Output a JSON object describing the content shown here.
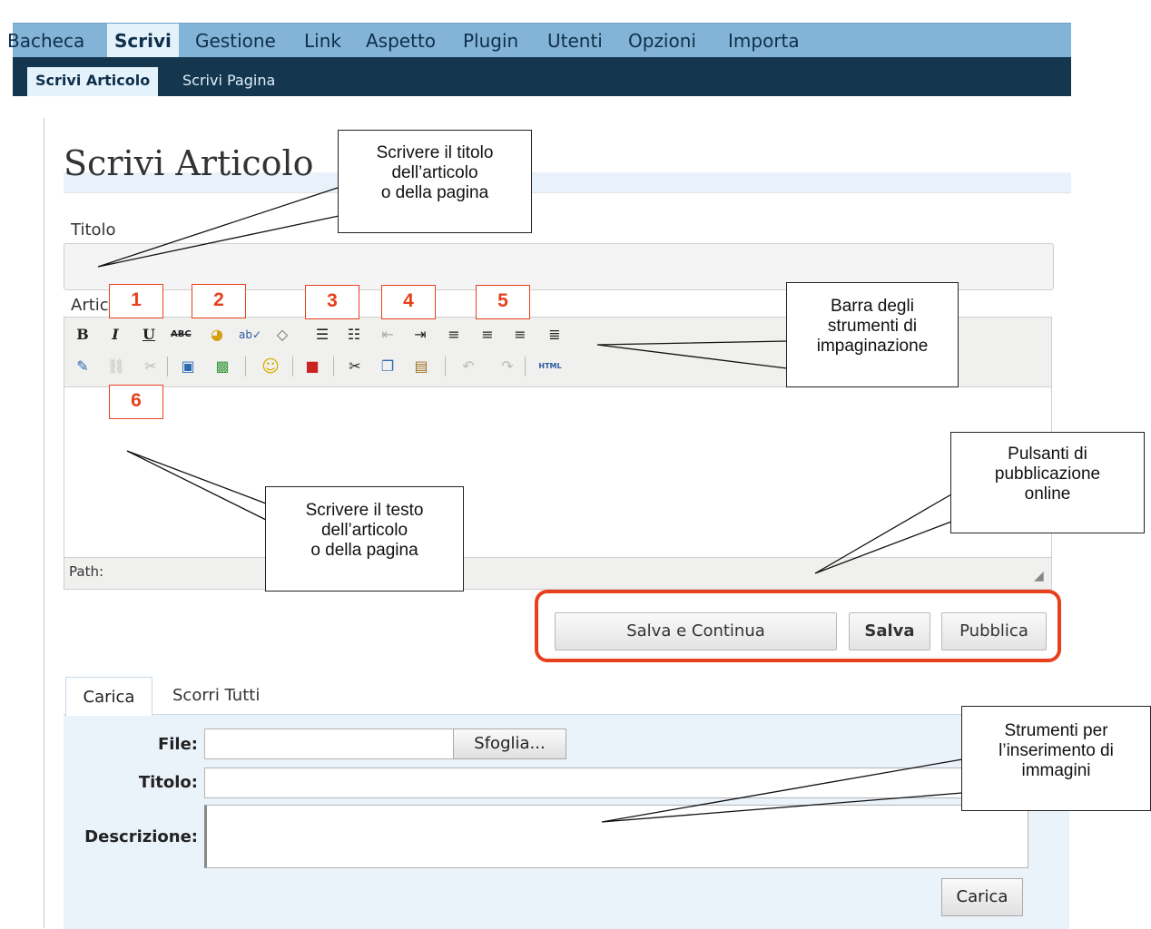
{
  "menu": {
    "items": [
      "Bacheca",
      "Scrivi",
      "Gestione",
      "Link",
      "Aspetto",
      "Plugin",
      "Utenti",
      "Opzioni",
      "Importa"
    ],
    "active": "Scrivi"
  },
  "submenu": {
    "items": [
      "Scrivi Articolo",
      "Scrivi Pagina"
    ],
    "active": "Scrivi Articolo"
  },
  "page": {
    "title": "Scrivi Articolo",
    "title_label": "Titolo",
    "article_label": "Articolo",
    "title_value": ""
  },
  "editor": {
    "path_label": "Path:",
    "toolbar_row1": [
      "bold-icon",
      "italic-icon",
      "underline-icon",
      "strikethrough-icon",
      "color-palette-icon",
      "spellcheck-icon",
      "eraser-icon",
      "ordered-list-icon",
      "unordered-list-icon",
      "outdent-icon",
      "indent-icon",
      "align-left-icon",
      "align-center-icon",
      "align-right-icon",
      "justify-icon"
    ],
    "toolbar_row2": [
      "edit-icon",
      "link-icon",
      "unlink-icon",
      "insert-image-icon",
      "image-icon",
      "smiley-icon",
      "stop-icon",
      "cut-icon",
      "copy-icon",
      "paste-icon",
      "undo-icon",
      "redo-icon",
      "html-icon"
    ],
    "glyphs": {
      "bold": "B",
      "italic": "I",
      "underline": "U",
      "strike": "ABC",
      "html": "HTML"
    }
  },
  "publish": {
    "save_continue": "Salva e Continua",
    "save": "Salva",
    "publish": "Pubblica"
  },
  "uploader": {
    "tabs": [
      "Carica",
      "Scorri Tutti"
    ],
    "file_label": "File:",
    "title_label": "Titolo:",
    "description_label": "Descrizione:",
    "browse": "Sfoglia...",
    "upload": "Carica"
  },
  "annotations": {
    "title_note": [
      "Scrivere il titolo",
      "dell’articolo",
      "o della pagina"
    ],
    "toolbar_note": [
      "Barra degli",
      "strumenti di",
      "impaginazione"
    ],
    "text_note": [
      "Scrivere il testo",
      "dell’articolo",
      "o della pagina"
    ],
    "publish_note": [
      "Pulsanti di",
      "pubblicazione",
      "online"
    ],
    "images_note": [
      "Strumenti per",
      "l’inserimento di",
      "immagini"
    ],
    "numbers": [
      "1",
      "2",
      "3",
      "4",
      "5",
      "6"
    ]
  },
  "colors": {
    "menu_bg": "#83b4d8",
    "submenu_bg": "#14374f",
    "accent_red": "#e8401c",
    "panel_bg": "#eaf2fa"
  }
}
